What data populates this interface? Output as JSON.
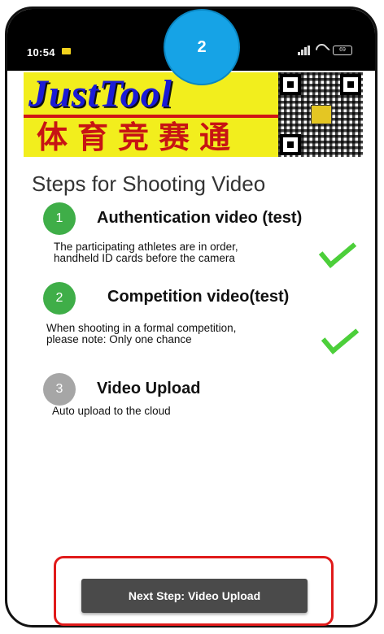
{
  "status_bar": {
    "time": "10:54",
    "battery": "69"
  },
  "badge": {
    "number": "2"
  },
  "banner": {
    "brand_en": "JustTool",
    "brand_cn": "体育竞赛通"
  },
  "screen": {
    "title": "Steps for Shooting Video",
    "steps": [
      {
        "number": "1",
        "title": "Authentication video (test)",
        "desc_line1": "The participating athletes are in order,",
        "desc_line2": "handheld ID cards before the camera",
        "completed": true,
        "circle_color": "#3fae48"
      },
      {
        "number": "2",
        "title": "Competition video(test)",
        "desc_line1": "When shooting in a formal competition,",
        "desc_line2": "please note: Only one chance",
        "completed": true,
        "circle_color": "#3fae48"
      },
      {
        "number": "3",
        "title": "Video Upload",
        "desc_line1": "Auto upload to the cloud",
        "completed": false,
        "circle_color": "#a6a6a6"
      }
    ],
    "next_button_label": "Next Step:  Video Upload"
  },
  "colors": {
    "accent_blue": "#16a3e6",
    "highlight_red": "#e01a1a",
    "check_green": "#4ccf3a"
  }
}
